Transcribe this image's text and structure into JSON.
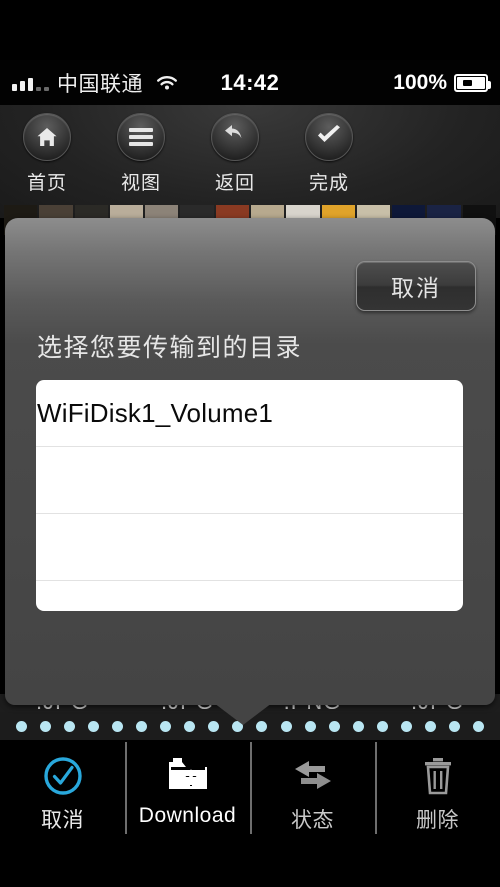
{
  "statusbar": {
    "signal_icon": "signal-bars-icon",
    "carrier": "中国联通",
    "wifi_icon": "wifi-icon",
    "time": "14:42",
    "battery_percent": "100%",
    "battery_icon": "battery-charging-icon"
  },
  "toolbar": {
    "buttons": [
      {
        "icon": "home-icon",
        "label": "首页"
      },
      {
        "icon": "list-view-icon",
        "label": "视图"
      },
      {
        "icon": "back-arrow-icon",
        "label": "返回"
      },
      {
        "icon": "checkmark-icon",
        "label": "完成"
      }
    ]
  },
  "thumbnails": [
    {
      "color": "#1d1a14"
    },
    {
      "color": "#4a4036"
    },
    {
      "color": "#2b2a26"
    },
    {
      "color": "#b9ad9a"
    },
    {
      "color": "#8c8378"
    },
    {
      "color": "#2a2a2a"
    },
    {
      "color": "#8a3a22"
    },
    {
      "color": "#b7a98e"
    },
    {
      "color": "#d8d4cc"
    },
    {
      "color": "#e0a32a"
    },
    {
      "color": "#c8bfa8"
    },
    {
      "color": "#0e1838"
    },
    {
      "color": "#1a2344"
    },
    {
      "color": "#101010"
    }
  ],
  "dialog": {
    "cancel_label": "取消",
    "title": "选择您要传输到的目录",
    "list_rows": [
      {
        "label": "WiFiDisk1_Volume1"
      },
      {
        "label": ""
      },
      {
        "label": ""
      },
      {
        "label": ""
      }
    ]
  },
  "filestrip": {
    "labels": [
      ".JPG",
      ".JPG",
      ".PNG",
      ".JPG"
    ]
  },
  "dots": {
    "count": 20,
    "color": "#b9e6f2"
  },
  "tabbar": {
    "tabs": [
      {
        "icon": "circle-check-icon",
        "label": "取消",
        "state": "enabled"
      },
      {
        "icon": "folder-download-icon",
        "label": "Download",
        "state": "selected"
      },
      {
        "icon": "transfer-arrows-icon",
        "label": "状态",
        "state": "dimmed"
      },
      {
        "icon": "trash-icon",
        "label": "删除",
        "state": "dimmed"
      }
    ]
  },
  "colors": {
    "accent_blue": "#29a8dc",
    "dot_blue": "#b9e6f2",
    "dialog_top": "#8d8d8d",
    "dialog_bottom": "#444444",
    "tab_dim": "#9a9a9a"
  }
}
